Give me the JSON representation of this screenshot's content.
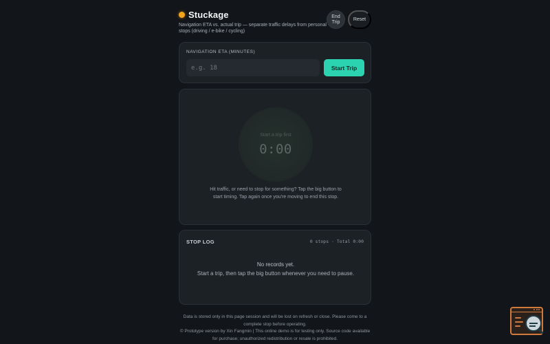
{
  "header": {
    "title": "Stuckage",
    "subtitle": "Navigation ETA vs. actual trip — separate traffic delays from personal stops (driving / e-bike / cycling)",
    "end_trip_label": "End Trip",
    "reset_label": "Reset",
    "status_color": "#f3a51c"
  },
  "eta": {
    "label": "NAVIGATION ETA (MINUTES)",
    "placeholder": "e.g. 18",
    "value": "",
    "start_label": "Start Trip",
    "accent_color": "#2bd3b1"
  },
  "timer": {
    "hint": "Start a trip first",
    "time": "0:00",
    "help": "Hit traffic, or need to stop for something? Tap the big button to start timing. Tap again once you're moving to end this stop."
  },
  "log": {
    "title": "STOP LOG",
    "summary": "0 stops · Total 0:00",
    "empty_title": "No records yet.",
    "empty_text": "Start a trip, then tap the big button whenever you need to pause."
  },
  "footer": {
    "line1": "Data is stored only in this page session and will be lost on refresh or close. Please come to a complete stop before operating.",
    "line2": "© Prototype version by Xin Fangmin | This online demo is for testing only. Source code available for purchase; unauthorized redistribution or resale is prohibited."
  },
  "widget": {
    "icon": "log-viewer-icon",
    "accent_color": "#d17a3c"
  }
}
